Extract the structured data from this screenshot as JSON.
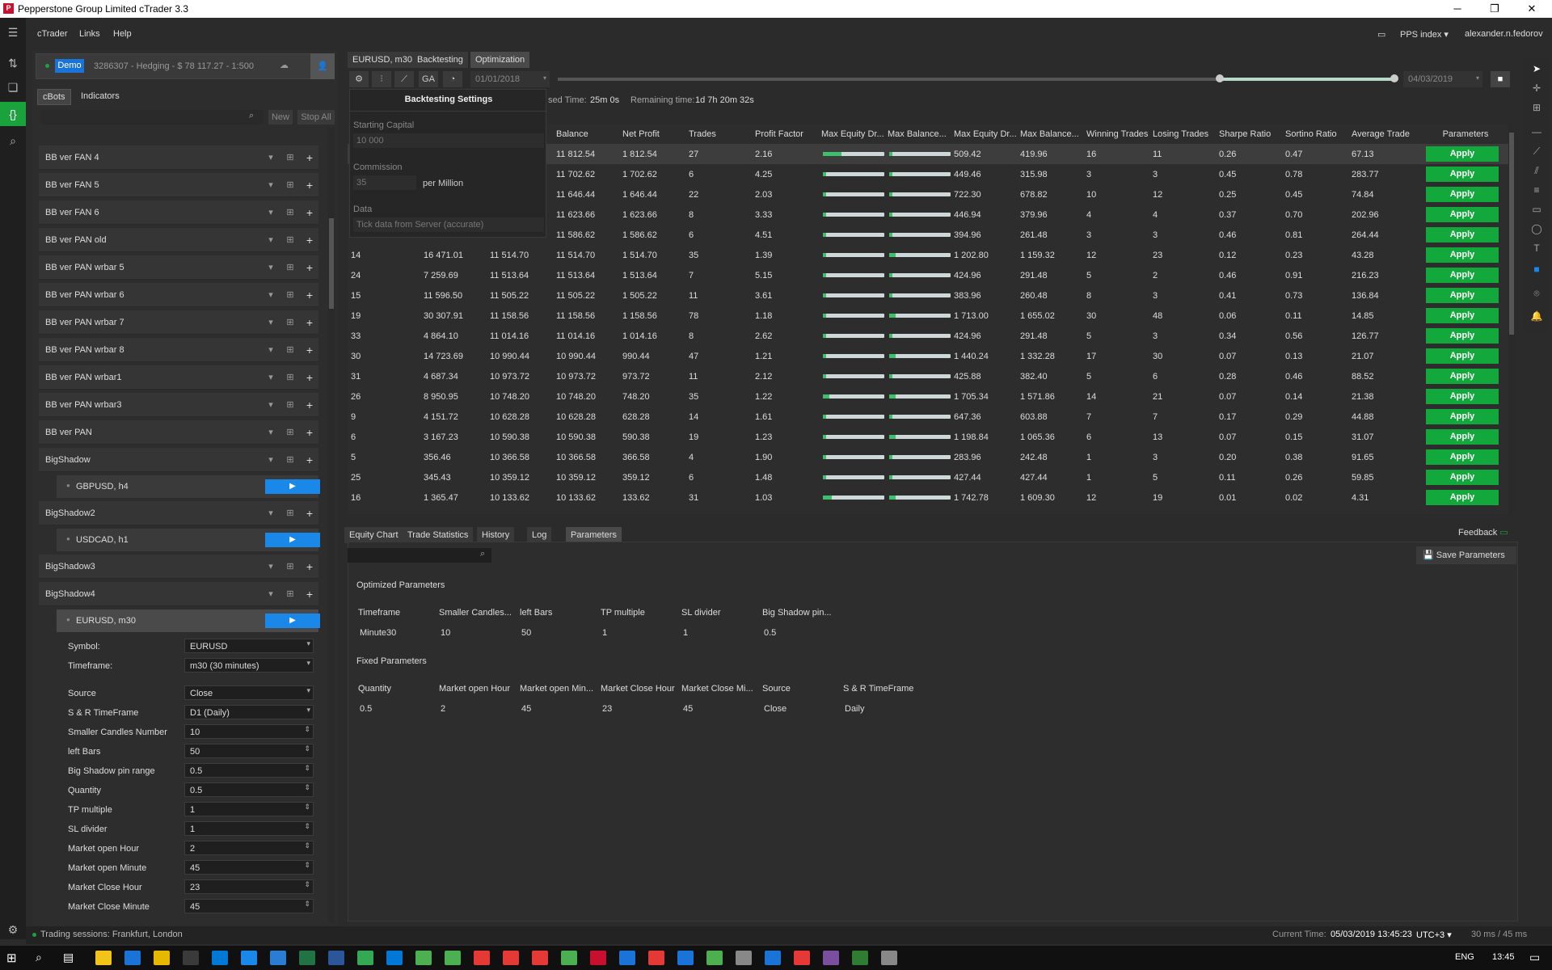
{
  "window": {
    "title": "Pepperstone Group Limited cTrader 3.3",
    "minimize": "─",
    "maximize": "❐",
    "close": "✕"
  },
  "menu": {
    "items": [
      "cTrader",
      "Links",
      "Help"
    ],
    "symbol_select": "PPS index",
    "user": "alexander.n.fedorov"
  },
  "account": {
    "badge": "Demo",
    "info": "3286307 - Hedging - $ 78 117.27 - 1:500"
  },
  "left_tabs": [
    "cBots",
    "Indicators"
  ],
  "left_toolbar": {
    "new": "New",
    "stop_all": "Stop All"
  },
  "bots": [
    {
      "name": "BB ver FAN 4"
    },
    {
      "name": "BB ver FAN 5"
    },
    {
      "name": "BB ver FAN 6"
    },
    {
      "name": "BB ver PAN  old"
    },
    {
      "name": "BB ver PAN wrbar 5"
    },
    {
      "name": "BB ver PAN wrbar 6"
    },
    {
      "name": "BB ver PAN wrbar 7"
    },
    {
      "name": "BB ver PAN wrbar 8"
    },
    {
      "name": "BB ver PAN wrbar1"
    },
    {
      "name": "BB ver PAN wrbar3"
    },
    {
      "name": "BB ver PAN"
    },
    {
      "name": "BigShadow"
    }
  ],
  "instances": {
    "bigshadow": "GBPUSD, h4",
    "bigshadow2": "USDCAD, h1",
    "bigshadow4": "EURUSD, m30"
  },
  "bots2": [
    "BigShadow2",
    "BigShadow3",
    "BigShadow4"
  ],
  "instance_params": [
    {
      "label": "Symbol:",
      "value": "EURUSD"
    },
    {
      "label": "Timeframe:",
      "value": "m30 (30 minutes)"
    }
  ],
  "bot_params": [
    {
      "label": "Source",
      "value": "Close"
    },
    {
      "label": "S & R TimeFrame",
      "value": "D1 (Daily)"
    },
    {
      "label": "Smaller Candles Number",
      "value": "10"
    },
    {
      "label": "left Bars",
      "value": "50"
    },
    {
      "label": "Big Shadow pin range",
      "value": "0.5"
    },
    {
      "label": "Quantity",
      "value": "0.5"
    },
    {
      "label": "TP multiple",
      "value": "1"
    },
    {
      "label": "SL divider",
      "value": "1"
    },
    {
      "label": "Market open Hour",
      "value": "2"
    },
    {
      "label": "Market open Minute",
      "value": "45"
    },
    {
      "label": "Market Close Hour",
      "value": "23"
    },
    {
      "label": "Market Close Minute",
      "value": "45"
    }
  ],
  "right_tabs": [
    "EURUSD, m30",
    "Backtesting",
    "Optimization"
  ],
  "toolbar": {
    "start_date": "01/01/2018",
    "end_date": "04/03/2019",
    "elapsed_label": "sed Time:",
    "elapsed": "25m 0s",
    "remaining_label": "Remaining time:",
    "remaining": "1d 7h 20m 32s",
    "slider_fill": 0.4,
    "ga": "GA"
  },
  "settings": {
    "title": "Backtesting Settings",
    "capital_label": "Starting Capital",
    "capital": "10 000",
    "commission_label": "Commission",
    "commission": "35",
    "commission_unit": "per Million",
    "data_label": "Data",
    "data": "Tick data from Server (accurate)"
  },
  "columns": [
    "Balance",
    "Net Profit",
    "Trades",
    "Profit Factor",
    "Max Equity Dr...",
    "Max Balance...",
    "Max Equity Dr...",
    "Max Balance...",
    "Winning Trades",
    "Losing Trades",
    "Sharpe Ratio",
    "Sortino Ratio",
    "Average Trade",
    "Parameters"
  ],
  "rows": [
    {
      "pass": "",
      "equity": "",
      "max": "",
      "balance": "11 812.54",
      "net": "1 812.54",
      "trades": "27",
      "pf": "2.16",
      "b1": 0.3,
      "b2": 0.05,
      "med": "509.42",
      "mbd": "419.96",
      "win": "16",
      "lose": "11",
      "sharpe": "0.26",
      "sortino": "0.47",
      "avg": "67.13",
      "apply": "Apply"
    },
    {
      "pass": "",
      "equity": "",
      "max": "",
      "balance": "11 702.62",
      "net": "1 702.62",
      "trades": "6",
      "pf": "4.25",
      "b1": 0.05,
      "b2": 0.05,
      "med": "449.46",
      "mbd": "315.98",
      "win": "3",
      "lose": "3",
      "sharpe": "0.45",
      "sortino": "0.78",
      "avg": "283.77",
      "apply": "Apply"
    },
    {
      "pass": "",
      "equity": "",
      "max": "",
      "balance": "11 646.44",
      "net": "1 646.44",
      "trades": "22",
      "pf": "2.03",
      "b1": 0.05,
      "b2": 0.05,
      "med": "722.30",
      "mbd": "678.82",
      "win": "10",
      "lose": "12",
      "sharpe": "0.25",
      "sortino": "0.45",
      "avg": "74.84",
      "apply": "Apply"
    },
    {
      "pass": "",
      "equity": "",
      "max": "",
      "balance": "11 623.66",
      "net": "1 623.66",
      "trades": "8",
      "pf": "3.33",
      "b1": 0.05,
      "b2": 0.05,
      "med": "446.94",
      "mbd": "379.96",
      "win": "4",
      "lose": "4",
      "sharpe": "0.37",
      "sortino": "0.70",
      "avg": "202.96",
      "apply": "Apply"
    },
    {
      "pass": "",
      "equity": "",
      "max": "",
      "balance": "11 586.62",
      "net": "1 586.62",
      "trades": "6",
      "pf": "4.51",
      "b1": 0.05,
      "b2": 0.05,
      "med": "394.96",
      "mbd": "261.48",
      "win": "3",
      "lose": "3",
      "sharpe": "0.46",
      "sortino": "0.81",
      "avg": "264.44",
      "apply": "Apply"
    },
    {
      "pass": "14",
      "equity": "16 471.01",
      "max": "11 514.70",
      "balance": "11 514.70",
      "net": "1 514.70",
      "trades": "35",
      "pf": "1.39",
      "b1": 0.05,
      "b2": 0.1,
      "med": "1 202.80",
      "mbd": "1 159.32",
      "win": "12",
      "lose": "23",
      "sharpe": "0.12",
      "sortino": "0.23",
      "avg": "43.28",
      "apply": "Apply"
    },
    {
      "pass": "24",
      "equity": "7 259.69",
      "max": "11 513.64",
      "balance": "11 513.64",
      "net": "1 513.64",
      "trades": "7",
      "pf": "5.15",
      "b1": 0.05,
      "b2": 0.05,
      "med": "424.96",
      "mbd": "291.48",
      "win": "5",
      "lose": "2",
      "sharpe": "0.46",
      "sortino": "0.91",
      "avg": "216.23",
      "apply": "Apply"
    },
    {
      "pass": "15",
      "equity": "11 596.50",
      "max": "11 505.22",
      "balance": "11 505.22",
      "net": "1 505.22",
      "trades": "11",
      "pf": "3.61",
      "b1": 0.05,
      "b2": 0.05,
      "med": "383.96",
      "mbd": "260.48",
      "win": "8",
      "lose": "3",
      "sharpe": "0.41",
      "sortino": "0.73",
      "avg": "136.84",
      "apply": "Apply"
    },
    {
      "pass": "19",
      "equity": "30 307.91",
      "max": "11 158.56",
      "balance": "11 158.56",
      "net": "1 158.56",
      "trades": "78",
      "pf": "1.18",
      "b1": 0.05,
      "b2": 0.1,
      "med": "1 713.00",
      "mbd": "1 655.02",
      "win": "30",
      "lose": "48",
      "sharpe": "0.06",
      "sortino": "0.11",
      "avg": "14.85",
      "apply": "Apply"
    },
    {
      "pass": "33",
      "equity": "4 864.10",
      "max": "11 014.16",
      "balance": "11 014.16",
      "net": "1 014.16",
      "trades": "8",
      "pf": "2.62",
      "b1": 0.05,
      "b2": 0.05,
      "med": "424.96",
      "mbd": "291.48",
      "win": "5",
      "lose": "3",
      "sharpe": "0.34",
      "sortino": "0.56",
      "avg": "126.77",
      "apply": "Apply"
    },
    {
      "pass": "30",
      "equity": "14 723.69",
      "max": "10 990.44",
      "balance": "10 990.44",
      "net": "990.44",
      "trades": "47",
      "pf": "1.21",
      "b1": 0.05,
      "b2": 0.1,
      "med": "1 440.24",
      "mbd": "1 332.28",
      "win": "17",
      "lose": "30",
      "sharpe": "0.07",
      "sortino": "0.13",
      "avg": "21.07",
      "apply": "Apply"
    },
    {
      "pass": "31",
      "equity": "4 687.34",
      "max": "10 973.72",
      "balance": "10 973.72",
      "net": "973.72",
      "trades": "11",
      "pf": "2.12",
      "b1": 0.05,
      "b2": 0.05,
      "med": "425.88",
      "mbd": "382.40",
      "win": "5",
      "lose": "6",
      "sharpe": "0.28",
      "sortino": "0.46",
      "avg": "88.52",
      "apply": "Apply"
    },
    {
      "pass": "26",
      "equity": "8 950.95",
      "max": "10 748.20",
      "balance": "10 748.20",
      "net": "748.20",
      "trades": "35",
      "pf": "1.22",
      "b1": 0.1,
      "b2": 0.1,
      "med": "1 705.34",
      "mbd": "1 571.86",
      "win": "14",
      "lose": "21",
      "sharpe": "0.07",
      "sortino": "0.14",
      "avg": "21.38",
      "apply": "Apply"
    },
    {
      "pass": "9",
      "equity": "4 151.72",
      "max": "10 628.28",
      "balance": "10 628.28",
      "net": "628.28",
      "trades": "14",
      "pf": "1.61",
      "b1": 0.05,
      "b2": 0.05,
      "med": "647.36",
      "mbd": "603.88",
      "win": "7",
      "lose": "7",
      "sharpe": "0.17",
      "sortino": "0.29",
      "avg": "44.88",
      "apply": "Apply"
    },
    {
      "pass": "6",
      "equity": "3 167.23",
      "max": "10 590.38",
      "balance": "10 590.38",
      "net": "590.38",
      "trades": "19",
      "pf": "1.23",
      "b1": 0.05,
      "b2": 0.1,
      "med": "1 198.84",
      "mbd": "1 065.36",
      "win": "6",
      "lose": "13",
      "sharpe": "0.07",
      "sortino": "0.15",
      "avg": "31.07",
      "apply": "Apply"
    },
    {
      "pass": "5",
      "equity": "356.46",
      "max": "10 366.58",
      "balance": "10 366.58",
      "net": "366.58",
      "trades": "4",
      "pf": "1.90",
      "b1": 0.05,
      "b2": 0.05,
      "med": "283.96",
      "mbd": "242.48",
      "win": "1",
      "lose": "3",
      "sharpe": "0.20",
      "sortino": "0.38",
      "avg": "91.65",
      "apply": "Apply"
    },
    {
      "pass": "25",
      "equity": "345.43",
      "max": "10 359.12",
      "balance": "10 359.12",
      "net": "359.12",
      "trades": "6",
      "pf": "1.48",
      "b1": 0.05,
      "b2": 0.05,
      "med": "427.44",
      "mbd": "427.44",
      "win": "1",
      "lose": "5",
      "sharpe": "0.11",
      "sortino": "0.26",
      "avg": "59.85",
      "apply": "Apply"
    },
    {
      "pass": "16",
      "equity": "1 365.47",
      "max": "10 133.62",
      "balance": "10 133.62",
      "net": "133.62",
      "trades": "31",
      "pf": "1.03",
      "b1": 0.15,
      "b2": 0.1,
      "med": "1 742.78",
      "mbd": "1 609.30",
      "win": "12",
      "lose": "19",
      "sharpe": "0.01",
      "sortino": "0.02",
      "avg": "4.31",
      "apply": "Apply"
    }
  ],
  "lower_tabs": [
    "Equity Chart",
    "Trade Statistics",
    "History",
    "Log",
    "Parameters"
  ],
  "feedback": "Feedback",
  "save_params": "Save Parameters",
  "optimized": {
    "title": "Optimized Parameters",
    "headers": [
      "Timeframe",
      "Smaller Candles...",
      "left Bars",
      "TP multiple",
      "SL divider",
      "Big Shadow pin..."
    ],
    "values": [
      "Minute30",
      "10",
      "50",
      "1",
      "1",
      "0.5"
    ]
  },
  "fixed": {
    "title": "Fixed Parameters",
    "headers": [
      "Quantity",
      "Market open Hour",
      "Market open Min...",
      "Market Close Hour",
      "Market Close Mi...",
      "Source",
      "S & R TimeFrame"
    ],
    "values": [
      "0.5",
      "2",
      "45",
      "23",
      "45",
      "Close",
      "Daily"
    ]
  },
  "status": {
    "sessions": "Trading sessions:  Frankfurt, London",
    "time_label": "Current Time:",
    "time": "05/03/2019 13:45:23",
    "tz": "UTC+3",
    "latency": "30 ms / 45 ms"
  },
  "taskbar": {
    "lang": "ENG",
    "clock": "13:45"
  }
}
